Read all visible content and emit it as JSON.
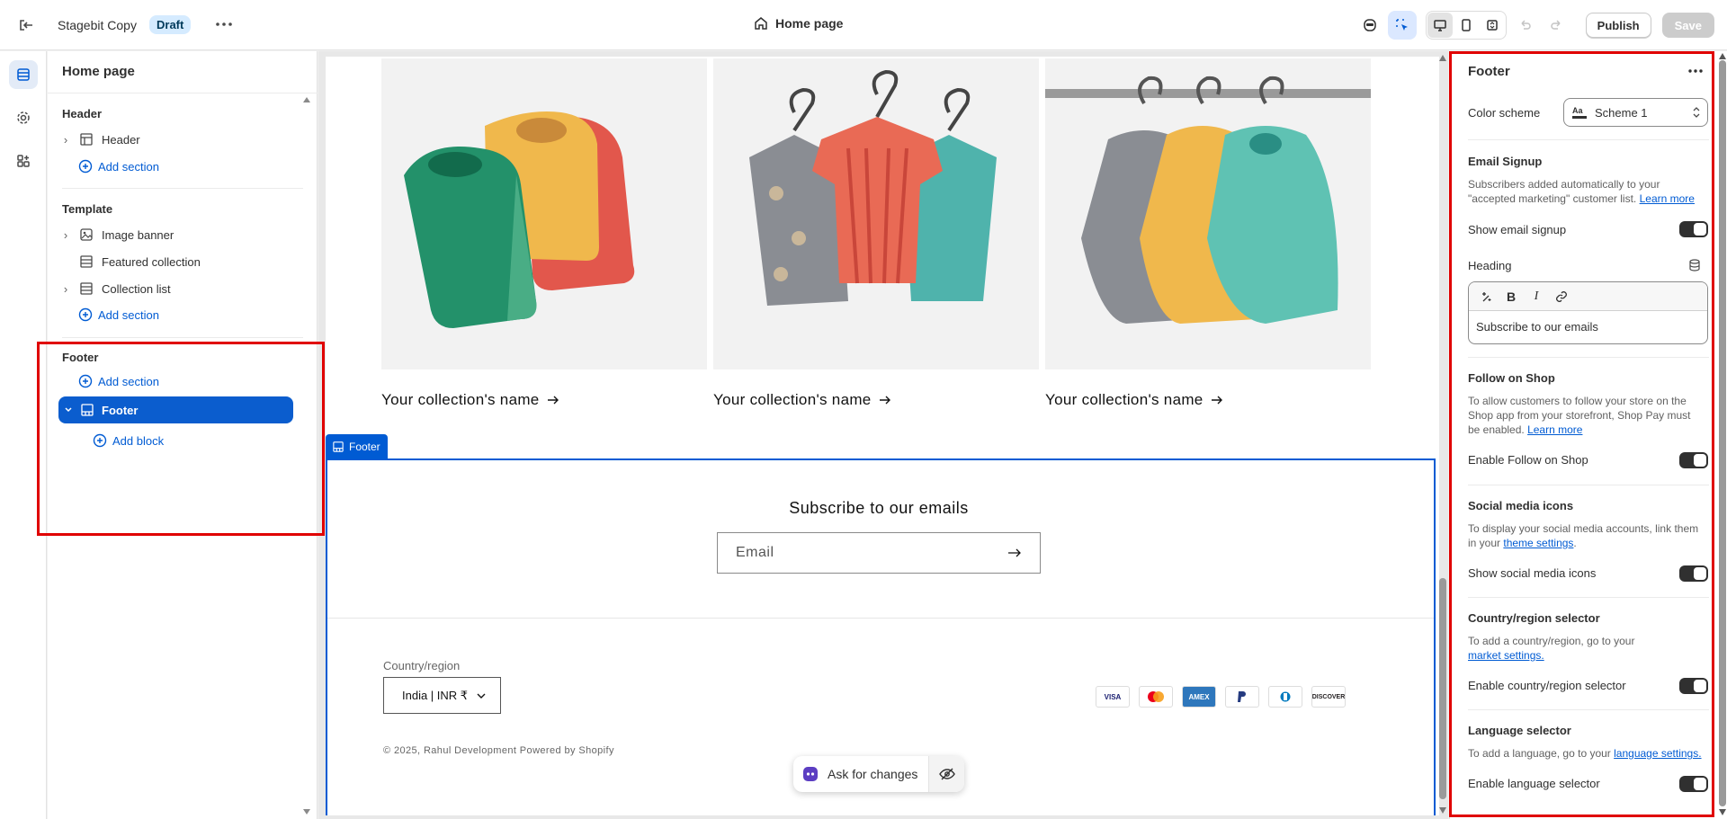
{
  "topbar": {
    "store_name": "Stagebit Copy",
    "status_badge": "Draft",
    "page_selector": "Home page",
    "publish_label": "Publish",
    "save_label": "Save"
  },
  "left_panel": {
    "title": "Home page",
    "header_group": "Header",
    "header_item": "Header",
    "add_section": "Add section",
    "template_group": "Template",
    "template_items": [
      "Image banner",
      "Featured collection",
      "Collection list"
    ],
    "footer_group": "Footer",
    "footer_item": "Footer",
    "add_block": "Add block"
  },
  "preview": {
    "collection_name": "Your collection's name",
    "footer_tag": "Footer",
    "subscribe_title": "Subscribe to our emails",
    "email_placeholder": "Email",
    "country_label": "Country/region",
    "country_value": "India | INR ₹",
    "payment_methods": [
      "VISA",
      "MC",
      "AMEX",
      "PayPal",
      "Diners",
      "DISCOVER"
    ],
    "copyright": "© 2025, Rahul Development Powered by Shopify",
    "ask_label": "Ask for changes"
  },
  "right_panel": {
    "title": "Footer",
    "color_scheme_label": "Color scheme",
    "color_scheme_value": "Scheme 1",
    "email_signup": {
      "heading": "Email Signup",
      "desc": "Subscribers added automatically to your \"accepted marketing\" customer list.",
      "link": "Learn more",
      "toggle_label": "Show email signup",
      "heading_label": "Heading",
      "heading_value": "Subscribe to our emails"
    },
    "follow_shop": {
      "heading": "Follow on Shop",
      "desc": "To allow customers to follow your store on the Shop app from your storefront, Shop Pay must be enabled.",
      "link": "Learn more",
      "toggle_label": "Enable Follow on Shop"
    },
    "social": {
      "heading": "Social media icons",
      "desc": "To display your social media accounts, link them in your",
      "link": "theme settings",
      "toggle_label": "Show social media icons"
    },
    "country": {
      "heading": "Country/region selector",
      "desc": "To add a country/region, go to your",
      "link": "market settings.",
      "toggle_label": "Enable country/region selector"
    },
    "language": {
      "heading": "Language selector",
      "desc": "To add a language, go to your",
      "link": "language settings.",
      "toggle_label": "Enable language selector"
    }
  },
  "colors": {
    "accent": "#005bd3",
    "selected": "#0b5dce",
    "highlight": "#e00000"
  }
}
